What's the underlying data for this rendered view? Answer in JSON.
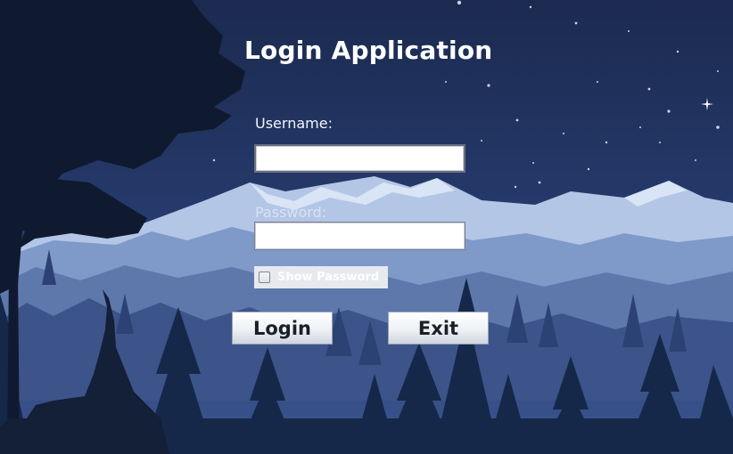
{
  "app": {
    "title": "Login Application"
  },
  "form": {
    "username_label": "Username:",
    "username_value": "",
    "password_label": "Password:",
    "password_value": "",
    "show_password_label": "Show Password",
    "show_password_checked": false
  },
  "buttons": {
    "login_label": "Login",
    "exit_label": "Exit"
  },
  "colors": {
    "sky": "#1d2b52",
    "mountain_snow": "#b9cbe8",
    "forest": "#1a2d52",
    "text": "#ffffff"
  }
}
